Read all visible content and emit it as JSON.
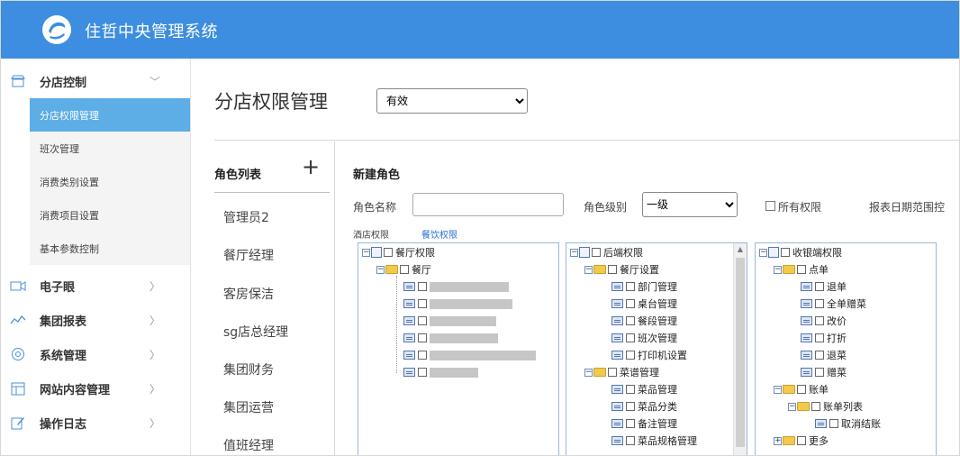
{
  "app": {
    "title": "住哲中央管理系统"
  },
  "sidebar": {
    "groups": [
      {
        "label": "分店控制",
        "icon": "store-icon",
        "expanded": true
      },
      {
        "label": "电子眼",
        "icon": "camera-icon"
      },
      {
        "label": "集团报表",
        "icon": "chart-icon"
      },
      {
        "label": "系统管理",
        "icon": "gear-icon"
      },
      {
        "label": "网站内容管理",
        "icon": "grid-icon"
      },
      {
        "label": "操作日志",
        "icon": "edit-icon"
      }
    ],
    "subitems": [
      {
        "label": "分店权限管理",
        "active": true
      },
      {
        "label": "班次管理"
      },
      {
        "label": "消费类别设置"
      },
      {
        "label": "消费项目设置"
      },
      {
        "label": "基本参数控制"
      }
    ]
  },
  "main": {
    "page_title": "分店权限管理",
    "status_value": "有效",
    "role_list": {
      "title": "角色列表",
      "add_symbol": "+",
      "items": [
        "管理员2",
        "餐厅经理",
        "客房保洁",
        "sg店总经理",
        "集团财务",
        "集团运营",
        "值班经理"
      ]
    },
    "form": {
      "title": "新建角色",
      "role_name_label": "角色名称",
      "role_level_label": "角色级别",
      "role_level_value": "一级",
      "all_perm_label": "所有权限",
      "report_range_label": "报表日期范围控",
      "tab_hotel": "酒店权限",
      "tab_dining": "餐饮权限"
    },
    "tree1": {
      "root": "餐厅权限",
      "folder": "餐厅"
    },
    "tree2": {
      "root": "后端权限",
      "folder1": "餐厅设置",
      "items1": [
        "部门管理",
        "桌台管理",
        "餐段管理",
        "班次管理",
        "打印机设置"
      ],
      "folder2": "菜谱管理",
      "items2": [
        "菜品管理",
        "菜品分类",
        "备注管理",
        "菜品规格管理"
      ]
    },
    "tree3": {
      "root": "收银端权限",
      "folder1": "点单",
      "items1": [
        "退单",
        "全单赠菜",
        "改价",
        "打折",
        "退菜",
        "赠菜"
      ],
      "folder2": "账单",
      "subfolder": "账单列表",
      "subitem": "取消结账",
      "folder3": "更多"
    }
  },
  "colors": {
    "header": "#3d8ee0",
    "active": "#5dade6",
    "link": "#2a6fd6"
  }
}
